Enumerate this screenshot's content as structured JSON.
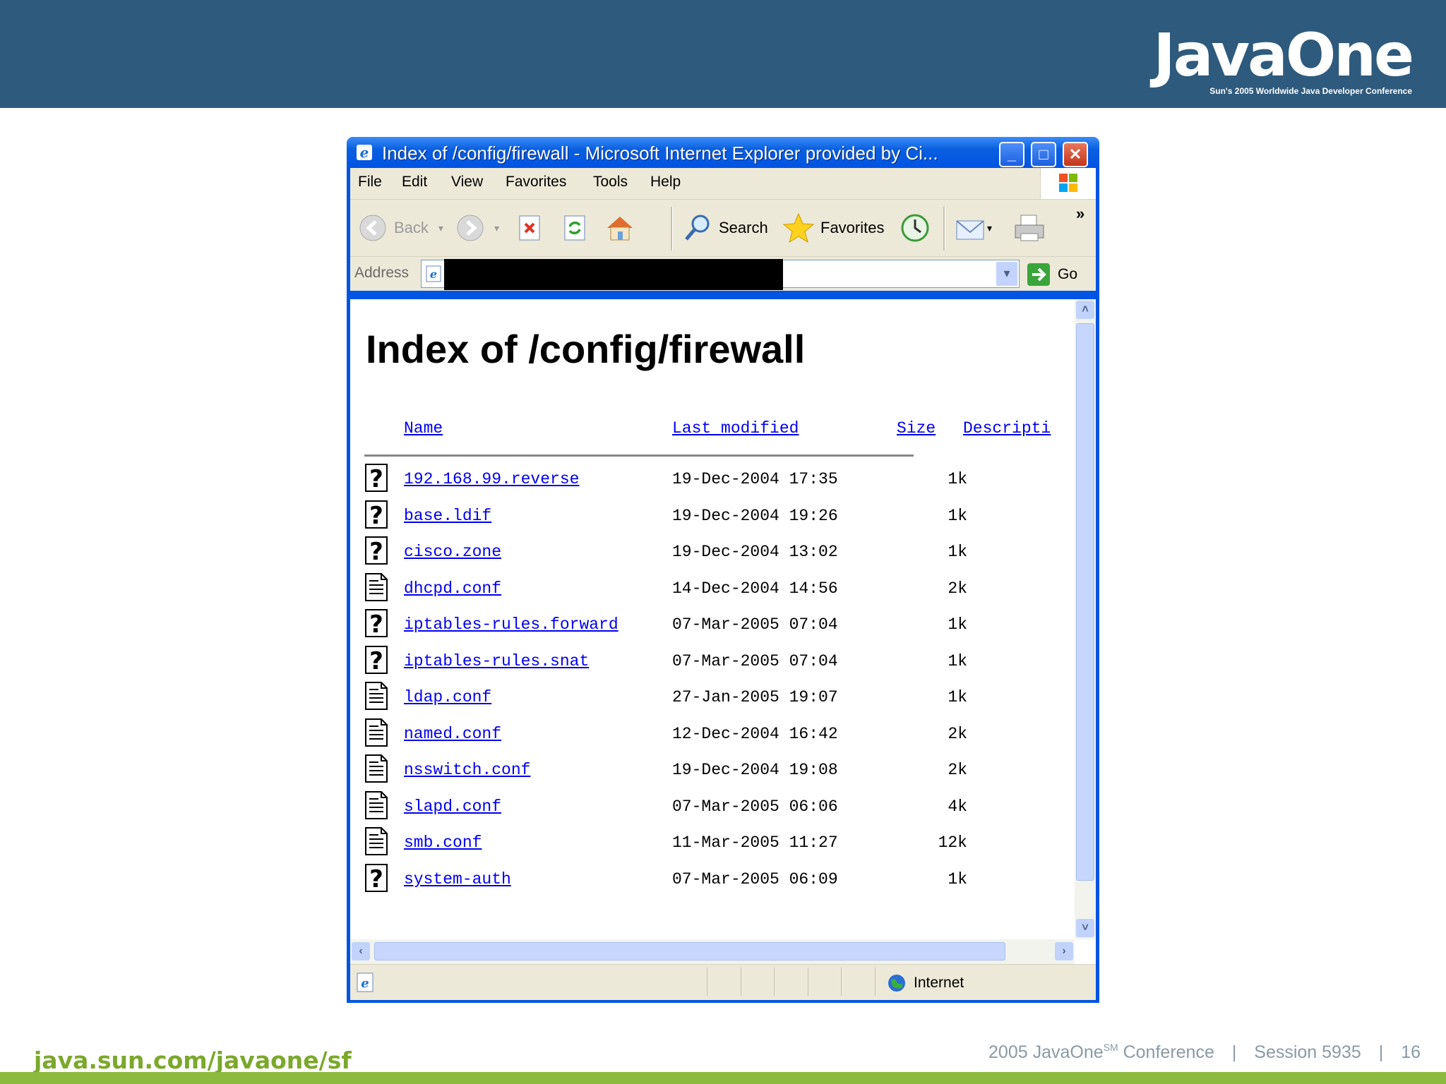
{
  "slide": {
    "logo_main": "JavaOne",
    "logo_sub": "Sun's 2005 Worldwide Java Developer Conference",
    "footer_url": "java.sun.com/javaone/sf",
    "footer_year_brand": "2005 JavaOne",
    "footer_sm": "SM",
    "footer_conf": " Conference",
    "footer_sep": "|",
    "footer_session": "Session 5935",
    "footer_page": "16",
    "colors": {
      "header_bg": "#2e5a7d",
      "footer_green": "#8bba3e",
      "xp_blue": "#0054e3"
    }
  },
  "window": {
    "title": "Index of /config/firewall - Microsoft Internet Explorer provided by Ci...",
    "menus": [
      "File",
      "Edit",
      "View",
      "Favorites",
      "Tools",
      "Help"
    ],
    "toolbar": {
      "back": "Back",
      "search": "Search",
      "favorites": "Favorites",
      "chevron": "»"
    },
    "address": {
      "label": "Address",
      "value": "",
      "go": "Go"
    },
    "status": {
      "zone": "Internet"
    }
  },
  "page": {
    "heading": "Index of /config/firewall",
    "columns": {
      "name": "Name",
      "modified": "Last modified",
      "size": "Size",
      "description": "Descripti"
    },
    "files": [
      {
        "name": "192.168.99.reverse",
        "modified": "19-Dec-2004 17:35",
        "size": "1k",
        "icon": "unknown-file-icon"
      },
      {
        "name": "base.ldif",
        "modified": "19-Dec-2004 19:26",
        "size": "1k",
        "icon": "unknown-file-icon"
      },
      {
        "name": "cisco.zone",
        "modified": "19-Dec-2004 13:02",
        "size": "1k",
        "icon": "unknown-file-icon"
      },
      {
        "name": "dhcpd.conf",
        "modified": "14-Dec-2004 14:56",
        "size": "2k",
        "icon": "text-file-icon"
      },
      {
        "name": "iptables-rules.forward",
        "modified": "07-Mar-2005 07:04",
        "size": "1k",
        "icon": "unknown-file-icon"
      },
      {
        "name": "iptables-rules.snat",
        "modified": "07-Mar-2005 07:04",
        "size": "1k",
        "icon": "unknown-file-icon"
      },
      {
        "name": "ldap.conf",
        "modified": "27-Jan-2005 19:07",
        "size": "1k",
        "icon": "text-file-icon"
      },
      {
        "name": "named.conf",
        "modified": "12-Dec-2004 16:42",
        "size": "2k",
        "icon": "text-file-icon"
      },
      {
        "name": "nsswitch.conf",
        "modified": "19-Dec-2004 19:08",
        "size": "2k",
        "icon": "text-file-icon"
      },
      {
        "name": "slapd.conf",
        "modified": "07-Mar-2005 06:06",
        "size": "4k",
        "icon": "text-file-icon"
      },
      {
        "name": "smb.conf",
        "modified": "11-Mar-2005 11:27",
        "size": "12k",
        "icon": "text-file-icon"
      },
      {
        "name": "system-auth",
        "modified": "07-Mar-2005 06:09",
        "size": "1k",
        "icon": "unknown-file-icon"
      }
    ]
  }
}
